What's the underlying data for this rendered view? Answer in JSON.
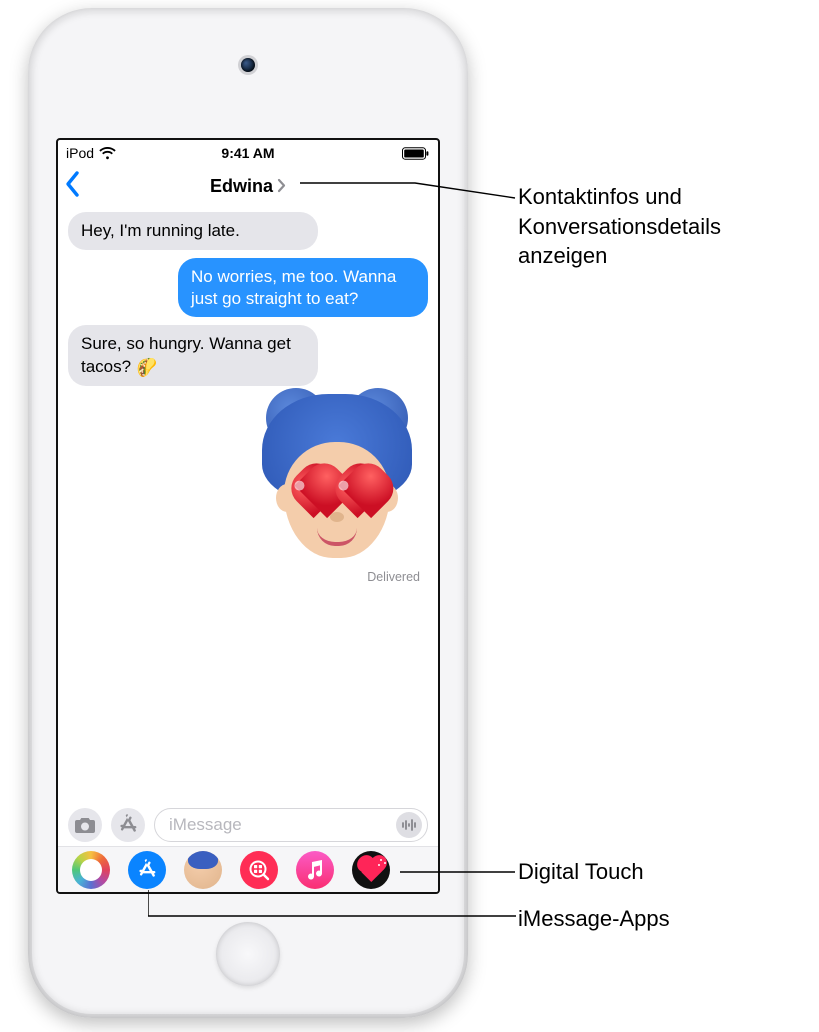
{
  "status_bar": {
    "device_label": "iPod",
    "time": "9:41 AM"
  },
  "nav": {
    "contact_name": "Edwina"
  },
  "messages": {
    "m1": "Hey, I'm running late.",
    "m2": "No worries, me too. Wanna just go straight to eat?",
    "m3_pre": "Sure, so hungry. Wanna get tacos? ",
    "m3_emoji": "🌮",
    "delivered": "Delivered"
  },
  "input": {
    "placeholder": "iMessage"
  },
  "callouts": {
    "contact_details": "Kontaktinfos und Konversationsdetails anzeigen",
    "digital_touch": "Digital Touch",
    "imessage_apps": "iMessage-Apps"
  },
  "app_drawer": {
    "photos": "photos",
    "store": "store",
    "memoji": "memoji",
    "image_search": "image-search",
    "music": "music",
    "digital_touch": "digital-touch"
  }
}
